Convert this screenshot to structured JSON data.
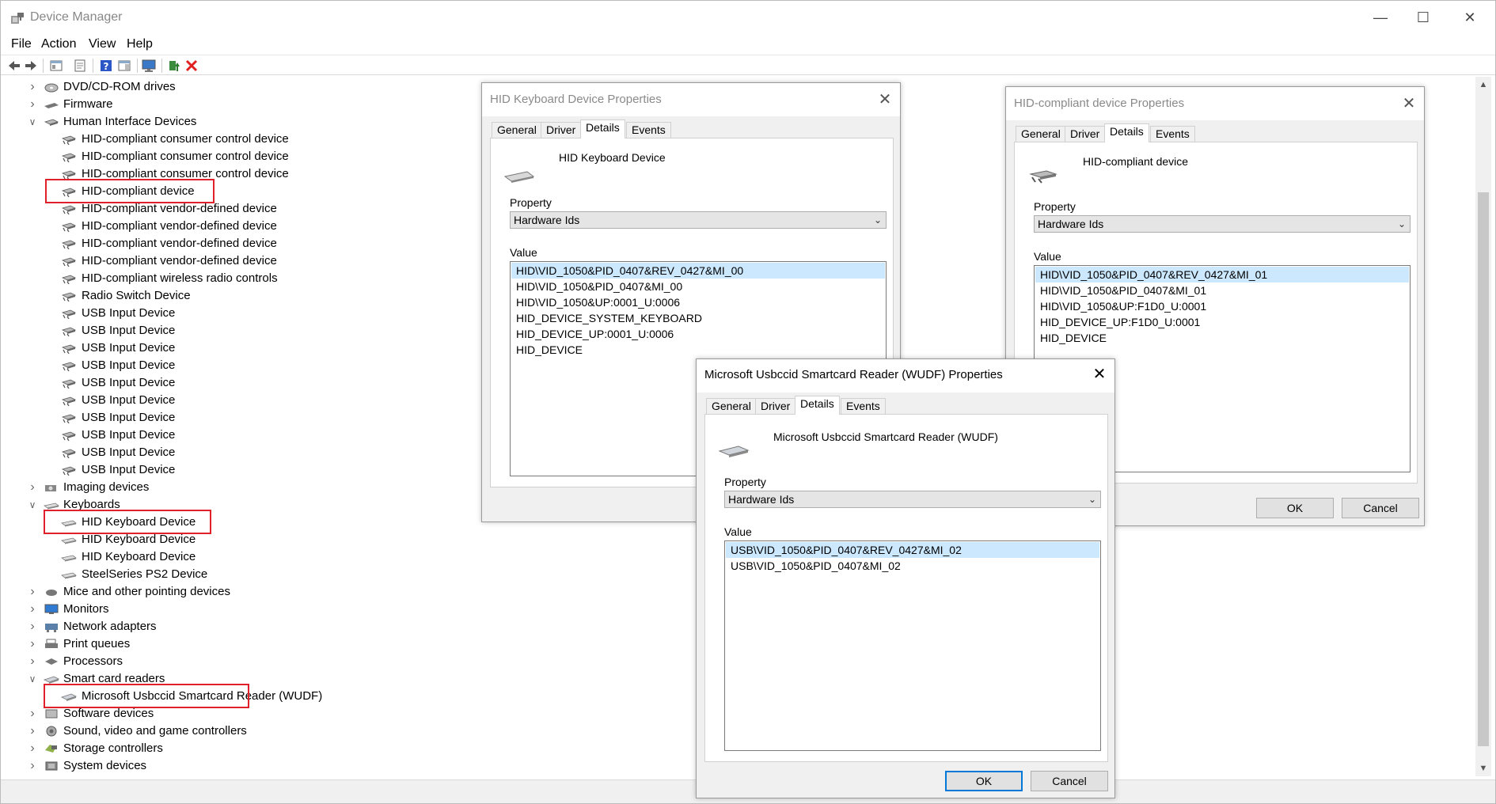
{
  "window": {
    "title": "Device Manager",
    "minimize_glyph": "—",
    "maximize_glyph": "☐",
    "close_glyph": "✕"
  },
  "menu": [
    "File",
    "Action",
    "View",
    "Help"
  ],
  "toolbar_icons": [
    "back-icon",
    "forward-icon",
    "show-hide-console-tree-icon",
    "properties-icon",
    "help-icon",
    "action-pane-icon",
    "monitor-icon",
    "update-driver-icon",
    "uninstall-device-icon"
  ],
  "tree": {
    "rows": [
      {
        "label": "DVD/CD-ROM drives",
        "level": 0,
        "expander": "collapsed",
        "icon": "dvd-drive-icon"
      },
      {
        "label": "Firmware",
        "level": 0,
        "expander": "collapsed",
        "icon": "firmware-icon"
      },
      {
        "label": "Human Interface Devices",
        "level": 0,
        "expander": "expanded",
        "icon": "hid-icon"
      },
      {
        "label": "HID-compliant consumer control device",
        "level": 1,
        "icon": "hid-device-icon"
      },
      {
        "label": "HID-compliant consumer control device",
        "level": 1,
        "icon": "hid-device-icon"
      },
      {
        "label": "HID-compliant consumer control device",
        "level": 1,
        "icon": "hid-device-icon"
      },
      {
        "label": "HID-compliant device",
        "level": 1,
        "icon": "hid-device-icon",
        "highlighted": true
      },
      {
        "label": "HID-compliant vendor-defined device",
        "level": 1,
        "icon": "hid-device-icon"
      },
      {
        "label": "HID-compliant vendor-defined device",
        "level": 1,
        "icon": "hid-device-icon"
      },
      {
        "label": "HID-compliant vendor-defined device",
        "level": 1,
        "icon": "hid-device-icon"
      },
      {
        "label": "HID-compliant vendor-defined device",
        "level": 1,
        "icon": "hid-device-icon"
      },
      {
        "label": "HID-compliant wireless radio controls",
        "level": 1,
        "icon": "hid-device-icon"
      },
      {
        "label": "Radio Switch Device",
        "level": 1,
        "icon": "hid-device-icon"
      },
      {
        "label": "USB Input Device",
        "level": 1,
        "icon": "hid-device-icon"
      },
      {
        "label": "USB Input Device",
        "level": 1,
        "icon": "hid-device-icon"
      },
      {
        "label": "USB Input Device",
        "level": 1,
        "icon": "hid-device-icon"
      },
      {
        "label": "USB Input Device",
        "level": 1,
        "icon": "hid-device-icon"
      },
      {
        "label": "USB Input Device",
        "level": 1,
        "icon": "hid-device-icon"
      },
      {
        "label": "USB Input Device",
        "level": 1,
        "icon": "hid-device-icon"
      },
      {
        "label": "USB Input Device",
        "level": 1,
        "icon": "hid-device-icon"
      },
      {
        "label": "USB Input Device",
        "level": 1,
        "icon": "hid-device-icon"
      },
      {
        "label": "USB Input Device",
        "level": 1,
        "icon": "hid-device-icon"
      },
      {
        "label": "USB Input Device",
        "level": 1,
        "icon": "hid-device-icon"
      },
      {
        "label": "Imaging devices",
        "level": 0,
        "expander": "collapsed",
        "icon": "camera-icon"
      },
      {
        "label": "Keyboards",
        "level": 0,
        "expander": "expanded",
        "icon": "keyboard-icon"
      },
      {
        "label": "HID Keyboard Device",
        "level": 1,
        "icon": "keyboard-icon",
        "highlighted": true
      },
      {
        "label": "HID Keyboard Device",
        "level": 1,
        "icon": "keyboard-icon"
      },
      {
        "label": "HID Keyboard Device",
        "level": 1,
        "icon": "keyboard-icon"
      },
      {
        "label": "SteelSeries PS2 Device",
        "level": 1,
        "icon": "keyboard-icon"
      },
      {
        "label": "Mice and other pointing devices",
        "level": 0,
        "expander": "collapsed",
        "icon": "mouse-icon"
      },
      {
        "label": "Monitors",
        "level": 0,
        "expander": "collapsed",
        "icon": "monitor-icon"
      },
      {
        "label": "Network adapters",
        "level": 0,
        "expander": "collapsed",
        "icon": "network-icon"
      },
      {
        "label": "Print queues",
        "level": 0,
        "expander": "collapsed",
        "icon": "printer-icon"
      },
      {
        "label": "Processors",
        "level": 0,
        "expander": "collapsed",
        "icon": "processor-icon"
      },
      {
        "label": "Smart card readers",
        "level": 0,
        "expander": "expanded",
        "icon": "smart-card-reader-icon"
      },
      {
        "label": "Microsoft Usbccid Smartcard Reader (WUDF)",
        "level": 1,
        "icon": "smart-card-reader-icon",
        "highlighted": true
      },
      {
        "label": "Software devices",
        "level": 0,
        "expander": "collapsed",
        "icon": "software-device-icon"
      },
      {
        "label": "Sound, video and game controllers",
        "level": 0,
        "expander": "collapsed",
        "icon": "speaker-icon"
      },
      {
        "label": "Storage controllers",
        "level": 0,
        "expander": "collapsed",
        "icon": "storage-icon"
      },
      {
        "label": "System devices",
        "level": 0,
        "expander": "collapsed",
        "icon": "system-device-icon"
      }
    ]
  },
  "dialogs": {
    "keyboard": {
      "title": "HID Keyboard Device Properties",
      "tabs": [
        "General",
        "Driver",
        "Details",
        "Events"
      ],
      "selected_tab": "Details",
      "device_name": "HID Keyboard Device",
      "property_label": "Property",
      "property_value": "Hardware Ids",
      "value_label": "Value",
      "values": [
        "HID\\VID_1050&PID_0407&REV_0427&MI_00",
        "HID\\VID_1050&PID_0407&MI_00",
        "HID\\VID_1050&UP:0001_U:0006",
        "HID_DEVICE_SYSTEM_KEYBOARD",
        "HID_DEVICE_UP:0001_U:0006",
        "HID_DEVICE"
      ]
    },
    "hid": {
      "title": "HID-compliant device Properties",
      "tabs": [
        "General",
        "Driver",
        "Details",
        "Events"
      ],
      "selected_tab": "Details",
      "device_name": "HID-compliant device",
      "property_label": "Property",
      "property_value": "Hardware Ids",
      "value_label": "Value",
      "values": [
        "HID\\VID_1050&PID_0407&REV_0427&MI_01",
        "HID\\VID_1050&PID_0407&MI_01",
        "HID\\VID_1050&UP:F1D0_U:0001",
        "HID_DEVICE_UP:F1D0_U:0001",
        "HID_DEVICE"
      ],
      "ok_label": "OK",
      "cancel_label": "Cancel"
    },
    "smartcard": {
      "title": "Microsoft Usbccid Smartcard Reader (WUDF) Properties",
      "tabs": [
        "General",
        "Driver",
        "Details",
        "Events"
      ],
      "selected_tab": "Details",
      "device_name": "Microsoft Usbccid Smartcard Reader (WUDF)",
      "property_label": "Property",
      "property_value": "Hardware Ids",
      "value_label": "Value",
      "values": [
        "USB\\VID_1050&PID_0407&REV_0427&MI_02",
        "USB\\VID_1050&PID_0407&MI_02"
      ],
      "ok_label": "OK",
      "cancel_label": "Cancel"
    }
  },
  "colors": {
    "highlight_box": "#e0202a",
    "selection": "#cce8ff",
    "default_button_border": "#0078d7"
  }
}
